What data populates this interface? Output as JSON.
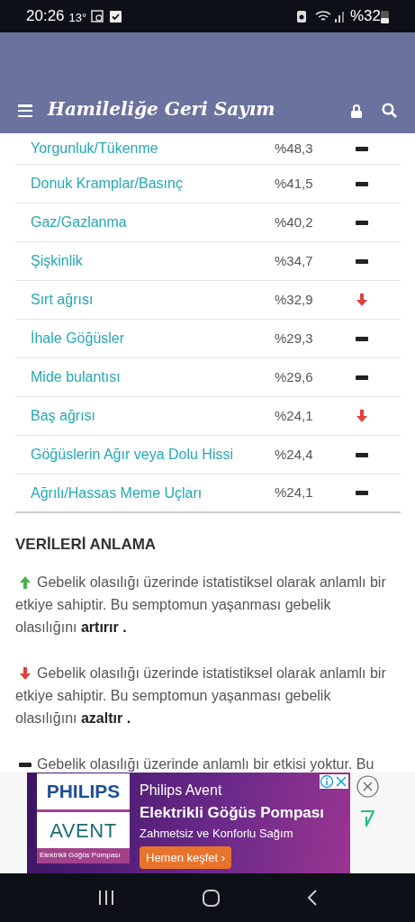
{
  "status_bar": {
    "time": "20:26",
    "temperature": "13°",
    "battery": "%32"
  },
  "header": {
    "title": "Hamileliğe Geri Sayım"
  },
  "table": {
    "rows": [
      {
        "symptom": "Yorgunluk/Tükenme",
        "percent": "%48,3",
        "kind": "neutral"
      },
      {
        "symptom": "Donuk Kramplar/Basınç",
        "percent": "%41,5",
        "kind": "neutral"
      },
      {
        "symptom": "Gaz/Gazlanma",
        "percent": "%40,2",
        "kind": "neutral"
      },
      {
        "symptom": "Şişkinlik",
        "percent": "%34,7",
        "kind": "neutral"
      },
      {
        "symptom": "Sırt ağrısı",
        "percent": "%32,9",
        "kind": "down"
      },
      {
        "symptom": "İhale Göğüsler",
        "percent": "%29,3",
        "kind": "neutral"
      },
      {
        "symptom": "Mide bulantısı",
        "percent": "%29,6",
        "kind": "neutral"
      },
      {
        "symptom": "Baş ağrısı",
        "percent": "%24,1",
        "kind": "down"
      },
      {
        "symptom": "Göğüslerin Ağır veya Dolu Hissi",
        "percent": "%24,4",
        "kind": "neutral"
      },
      {
        "symptom": "Ağrılı/Hassas Meme Uçları",
        "percent": "%24,1",
        "kind": "neutral"
      }
    ]
  },
  "legend": {
    "heading": "VERİLERİ ANLAMA",
    "items": [
      {
        "kind": "up",
        "text": "Gebelik olasılığı üzerinde istatistiksel olarak anlamlı bir etkiye sahiptir. Bu semptomun yaşanması gebelik olasılığını **artırır .**"
      },
      {
        "kind": "down",
        "text": "Gebelik olasılığı üzerinde istatistiksel olarak anlamlı bir etkiye sahiptir. Bu semptomun yaşanması gebelik olasılığını **azaltır .**"
      },
      {
        "kind": "neutral",
        "text": "Gebelik olasılığı üzerinde anlamlı bir etkisi yoktur. Bu"
      }
    ]
  },
  "ad": {
    "brand_top": "PHILIPS",
    "brand_bottom": "AVENT",
    "brand_caption": "Elektrikli Göğüs Pompası",
    "line_1": "Philips Avent",
    "line_2": "Elektrikli Göğüs Pompası",
    "line_3": "Zahmetsiz ve Konforlu Sağım",
    "cta": "Hemen keşfet ›"
  }
}
